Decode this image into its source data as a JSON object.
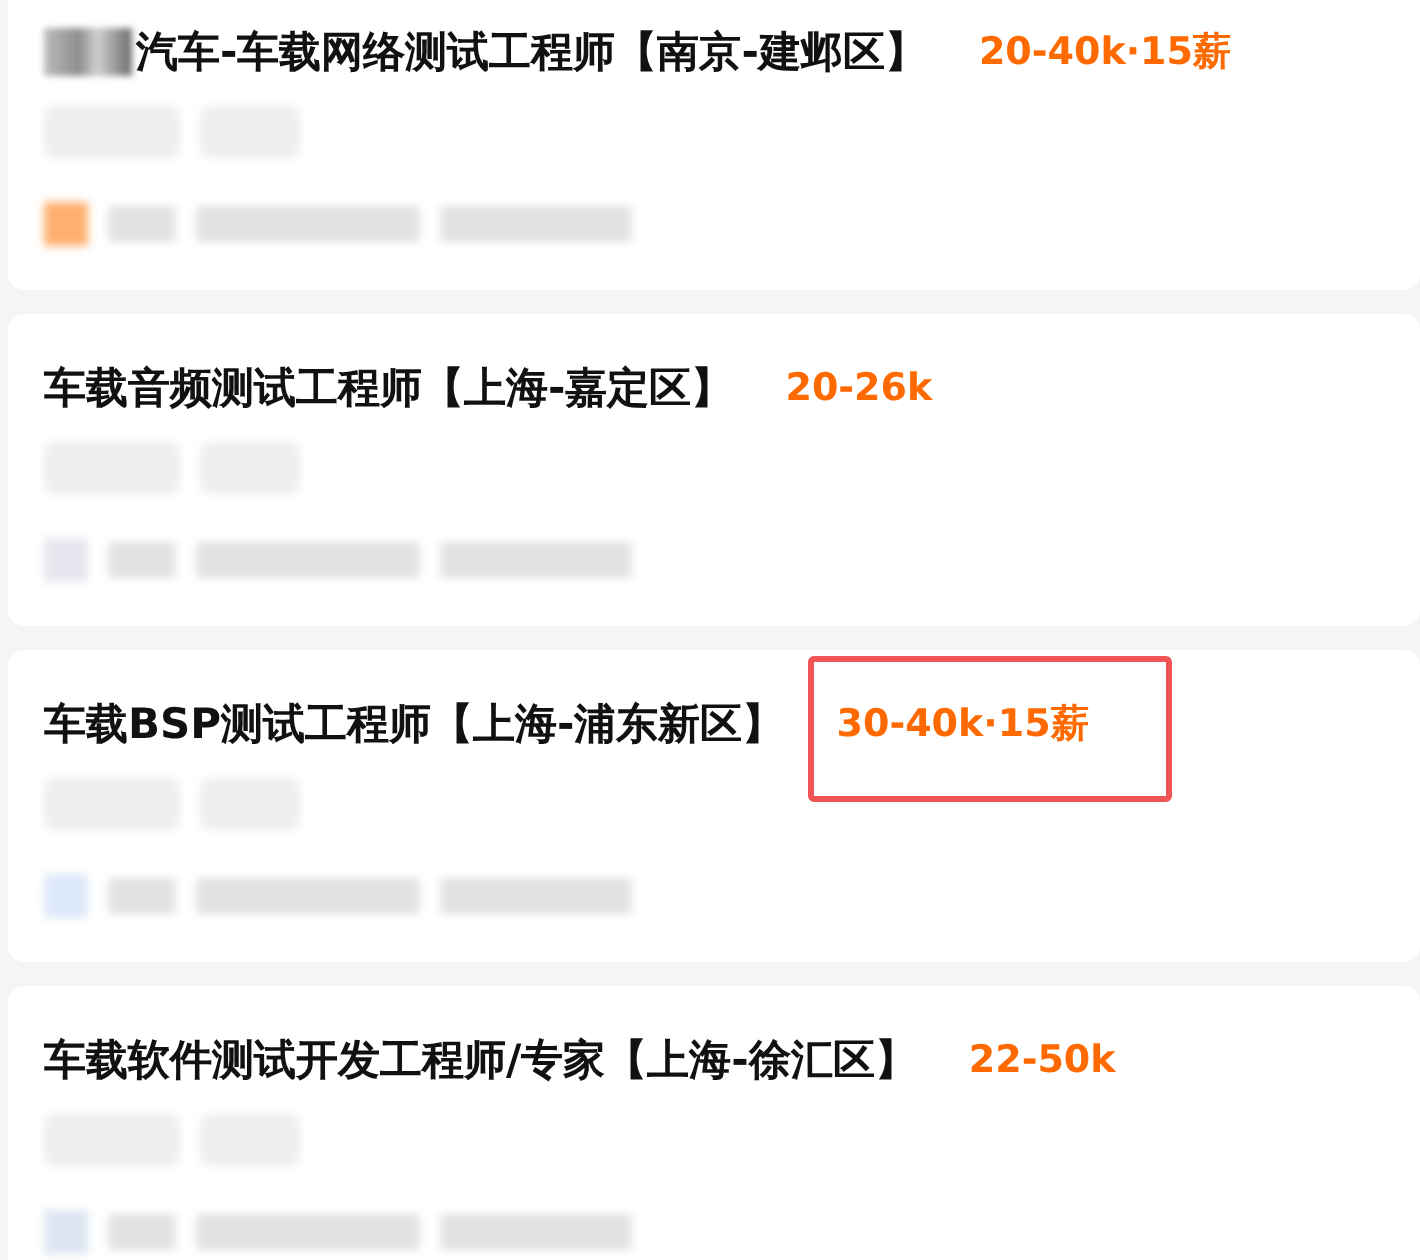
{
  "jobs": [
    {
      "title": "汽车-车载网络测试工程师【南京-建邺区】",
      "title_prefix_redacted": true,
      "salary": "20-40k·15薪",
      "highlighted": false
    },
    {
      "title": "车载音频测试工程师【上海-嘉定区】",
      "title_prefix_redacted": false,
      "salary": "20-26k",
      "highlighted": false
    },
    {
      "title": "车载BSP测试工程师【上海-浦东新区】",
      "title_prefix_redacted": false,
      "salary": "30-40k·15薪",
      "highlighted": true
    },
    {
      "title": "车载软件测试开发工程师/专家【上海-徐汇区】",
      "title_prefix_redacted": false,
      "salary": "22-50k",
      "highlighted": false
    }
  ]
}
